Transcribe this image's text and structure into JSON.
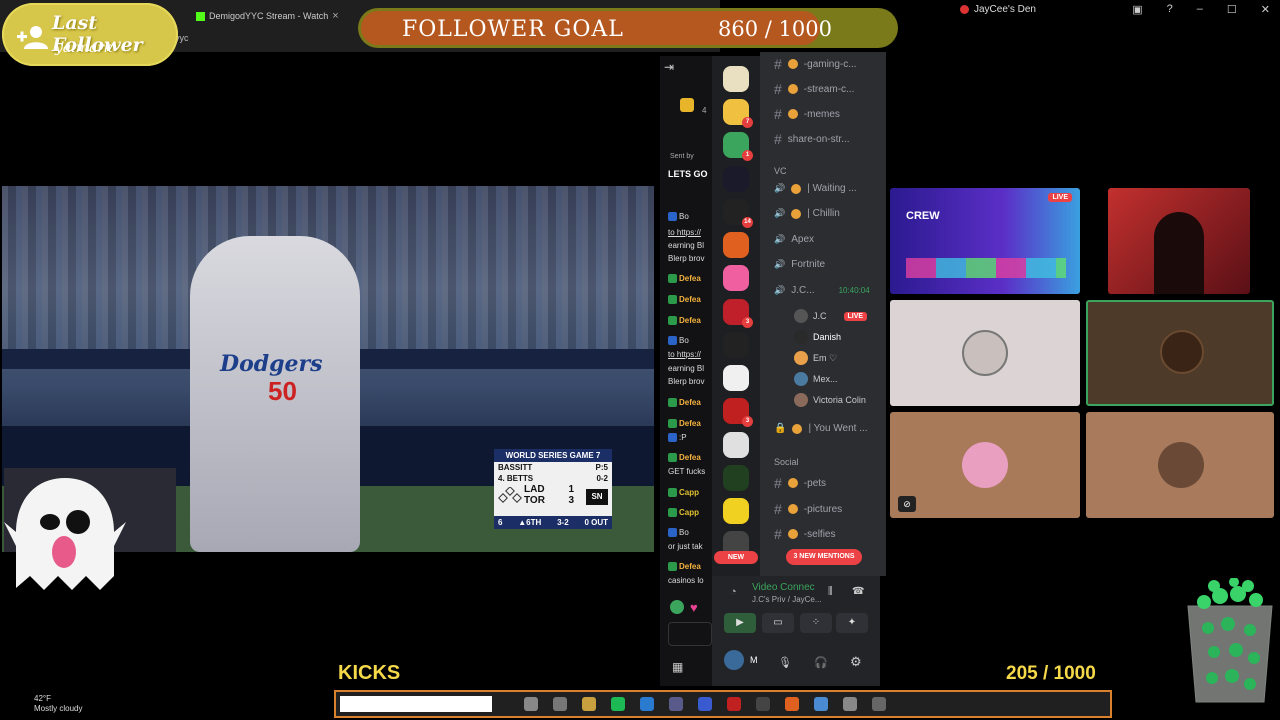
{
  "browser": {
    "tab_title": "DemigodYYC Stream - Watch",
    "tab_close": "×",
    "url_fragment": "dyyc"
  },
  "last_follower": {
    "title": "Last Follower",
    "name": "yalmark"
  },
  "follower_goal": {
    "title": "FOLLOWER GOAL",
    "count_text": "860 / 1000",
    "current": 860,
    "target": 1000
  },
  "window": {
    "title": "JayCee's Den"
  },
  "scorebug": {
    "header": "WORLD SERIES GAME 7",
    "pitcher": "BASSITT",
    "pitch_count": "P:5",
    "batter": "4. BETTS",
    "count": "0-2",
    "teams": [
      {
        "abbr": "LAD",
        "score": "1"
      },
      {
        "abbr": "TOR",
        "score": "3"
      }
    ],
    "network": "SN",
    "outs_left": "6",
    "inning": "▲6TH",
    "balls_strikes": "3-2",
    "outs": "0 OUT"
  },
  "player": {
    "team_script": "Dodgers",
    "number": "50"
  },
  "chat": {
    "pinned_sender": "Sent by",
    "pinned_msg": "LETS GO",
    "lines": [
      {
        "text": "Bo",
        "type": "normal"
      },
      {
        "text": "to https://",
        "type": "link"
      },
      {
        "text": "earning Bl",
        "type": "normal"
      },
      {
        "text": "Blerp brov",
        "type": "normal"
      },
      {
        "text": "Defea",
        "type": "def"
      },
      {
        "text": "Defea",
        "type": "def"
      },
      {
        "text": "Defea",
        "type": "def"
      },
      {
        "text": "Bo",
        "type": "normal"
      },
      {
        "text": "to https://",
        "type": "link"
      },
      {
        "text": "earning Bl",
        "type": "normal"
      },
      {
        "text": "Blerp brov",
        "type": "normal"
      },
      {
        "text": "Defea",
        "type": "def"
      },
      {
        "text": "Defea",
        "type": "def"
      },
      {
        "text": ":P",
        "type": "normal"
      },
      {
        "text": "Defea",
        "type": "def"
      },
      {
        "text": "GET fucks",
        "type": "normal"
      },
      {
        "text": "Capp",
        "type": "cap"
      },
      {
        "text": "Capp",
        "type": "cap"
      },
      {
        "text": "Bo",
        "type": "normal"
      },
      {
        "text": "or just tak",
        "type": "normal"
      },
      {
        "text": "Defea",
        "type": "def"
      },
      {
        "text": "casinos lo",
        "type": "normal"
      }
    ],
    "viewer_count": "4"
  },
  "discord": {
    "server_badges": [
      "7",
      "1",
      "14",
      "3",
      "3"
    ],
    "channels_top": [
      {
        "name": "-gaming-c..."
      },
      {
        "name": "-stream-c..."
      },
      {
        "name": "-memes"
      },
      {
        "name": "share-on-str..."
      }
    ],
    "vc_category": "VC",
    "voice_channels": [
      {
        "name": "| Waiting ..."
      },
      {
        "name": "| Chillin"
      },
      {
        "name": "Apex"
      },
      {
        "name": "Fortnite"
      },
      {
        "name": "J.C...",
        "time": "10:40:04"
      }
    ],
    "members": [
      {
        "name": "J.C",
        "live": "LIVE"
      },
      {
        "name": "Danish"
      },
      {
        "name": "Em ♡"
      },
      {
        "name": "Mex..."
      },
      {
        "name": "Victoria Colin"
      }
    ],
    "locked_channel": "| You Went ...",
    "social_category": "Social",
    "social_channels": [
      {
        "name": "-pets"
      },
      {
        "name": "-pictures"
      },
      {
        "name": "-selfies"
      }
    ],
    "new_badge": "NEW",
    "mentions_badge": "3 NEW MENTIONS",
    "voice_status": "Video Connec",
    "voice_sub": "J.C's Priv / JayCe...",
    "user_initial": "M"
  },
  "stream_grid": {
    "promo_title": "CREW",
    "promo_live": "LIVE"
  },
  "kicks": {
    "label": "KICKS",
    "goal_text": "205  / 1000",
    "current": 205,
    "target": 1000
  },
  "weather": {
    "temp": "42°F",
    "condition": "Mostly cloudy"
  },
  "colors": {
    "goal_fill": "#b5581f",
    "goal_track": "#7a7a1a",
    "follower_bg": "#d6c64a",
    "kicks_text": "#f5d949",
    "taskbar_border": "#d9822b"
  }
}
